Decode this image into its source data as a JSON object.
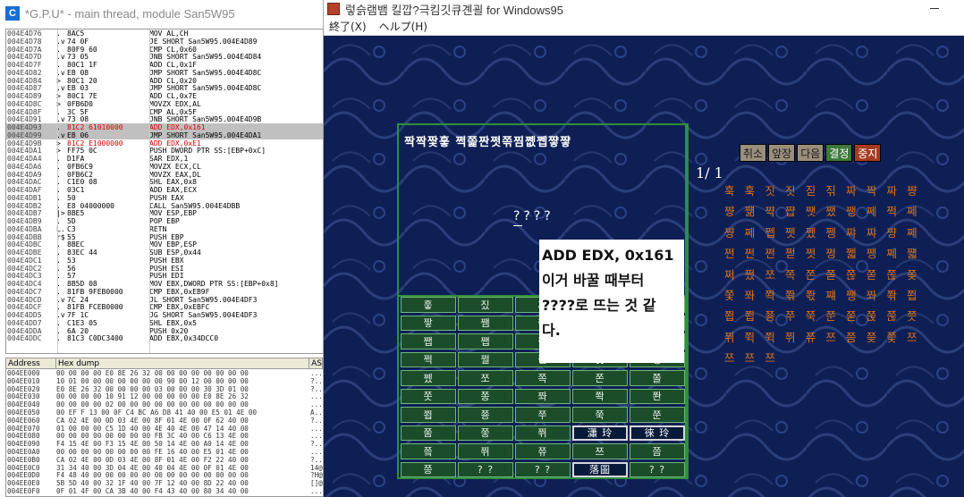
{
  "debugger": {
    "title": "*G.P.U* - main thread, module San5W95",
    "icon_letter": "C",
    "cpu_rows": [
      {
        "addr": "004E4D76",
        "mark": ".",
        "hex": "8AC5",
        "dis": "MOV AL,CH"
      },
      {
        "addr": "004E4D78",
        "mark": ".v",
        "hex": "74 0F",
        "dis": "JE SHORT San5W95.004E4D89"
      },
      {
        "addr": "004E4D7A",
        "mark": ".",
        "hex": "80F9 60",
        "dis": "CMP CL,0x60"
      },
      {
        "addr": "004E4D7D",
        "mark": ".v",
        "hex": "73 05",
        "dis": "JNB SHORT San5W95.004E4D84"
      },
      {
        "addr": "004E4D7F",
        "mark": ".",
        "hex": "80C1 1F",
        "dis": "ADD CL,0x1F"
      },
      {
        "addr": "004E4D82",
        "mark": ".v",
        "hex": "EB 08",
        "dis": "JMP SHORT San5W95.004E4D8C"
      },
      {
        "addr": "004E4D84",
        "mark": ">",
        "hex": "80C1 20",
        "dis": "ADD CL,0x20"
      },
      {
        "addr": "004E4D87",
        "mark": ".v",
        "hex": "EB 03",
        "dis": "JMP SHORT San5W95.004E4D8C"
      },
      {
        "addr": "004E4D89",
        "mark": ">",
        "hex": "80C1 7E",
        "dis": "ADD CL,0x7E"
      },
      {
        "addr": "004E4D8C",
        "mark": ">",
        "hex": "0FB6D0",
        "dis": "MOVZX EDX,AL"
      },
      {
        "addr": "004E4D8F",
        "mark": ".",
        "hex": "3C 5F",
        "dis": "CMP AL,0x5F"
      },
      {
        "addr": "004E4D91",
        "mark": ".v",
        "hex": "73 08",
        "dis": "JNB SHORT San5W95.004E4D9B"
      },
      {
        "addr": "004E4D93",
        "mark": ".",
        "hex": "81C2 61010000",
        "dis": "ADD EDX,0x161",
        "sel": true,
        "red": true
      },
      {
        "addr": "004E4D99",
        "mark": ".v",
        "hex": "EB 06",
        "dis": "JMP SHORT San5W95.004E4DA1",
        "sel": true
      },
      {
        "addr": "004E4D9B",
        "mark": ">",
        "hex": "81C2 E1000000",
        "dis": "ADD EDX,0xE1",
        "red": true
      },
      {
        "addr": "004E4DA1",
        "mark": ">",
        "hex": "FF75 0C",
        "dis": "PUSH DWORD PTR SS:[EBP+0xC]"
      },
      {
        "addr": "004E4DA4",
        "mark": ".",
        "hex": "D1FA",
        "dis": "SAR EDX,1"
      },
      {
        "addr": "004E4DA6",
        "mark": ".",
        "hex": "0FB6C9",
        "dis": "MOVZX ECX,CL"
      },
      {
        "addr": "004E4DA9",
        "mark": ".",
        "hex": "0FB6C2",
        "dis": "MOVZX EAX,DL"
      },
      {
        "addr": "004E4DAC",
        "mark": ".",
        "hex": "C1E0 08",
        "dis": "SHL EAX,0x8"
      },
      {
        "addr": "004E4DAF",
        "mark": ".",
        "hex": "03C1",
        "dis": "ADD EAX,ECX"
      },
      {
        "addr": "004E4DB1",
        "mark": ".",
        "hex": "50",
        "dis": "PUSH EAX"
      },
      {
        "addr": "004E4DB2",
        "mark": ".",
        "hex": "E8 04000000",
        "dis": "CALL San5W95.004E4DBB"
      },
      {
        "addr": "004E4DB7",
        "mark": "|>",
        "hex": "8BE5",
        "dis": "MOV ESP,EBP"
      },
      {
        "addr": "004E4DB9",
        "mark": ".",
        "hex": "5D",
        "dis": "POP EBP"
      },
      {
        "addr": "004E4DBA",
        "mark": "L.",
        "hex": "C3",
        "dis": "RETN"
      },
      {
        "addr": "004E4DBB",
        "mark": "r$",
        "hex": "55",
        "dis": "PUSH EBP"
      },
      {
        "addr": "004E4DBC",
        "mark": ".",
        "hex": "8BEC",
        "dis": "MOV EBP,ESP"
      },
      {
        "addr": "004E4DBE",
        "mark": ".",
        "hex": "83EC 44",
        "dis": "SUB ESP,0x44"
      },
      {
        "addr": "004E4DC1",
        "mark": ".",
        "hex": "53",
        "dis": "PUSH EBX"
      },
      {
        "addr": "004E4DC2",
        "mark": ".",
        "hex": "56",
        "dis": "PUSH ESI"
      },
      {
        "addr": "004E4DC3",
        "mark": ".",
        "hex": "57",
        "dis": "PUSH EDI"
      },
      {
        "addr": "004E4DC4",
        "mark": ".",
        "hex": "8B5D 08",
        "dis": "MOV EBX,DWORD PTR SS:[EBP+0x8]"
      },
      {
        "addr": "004E4DC7",
        "mark": ".",
        "hex": "81FB 9FEB0000",
        "dis": "CMP EBX,0xEB9F"
      },
      {
        "addr": "004E4DCD",
        "mark": ".v",
        "hex": "7C 24",
        "dis": "JL SHORT San5W95.004E4DF3"
      },
      {
        "addr": "004E4DCF",
        "mark": ".",
        "hex": "81FB FCEB0000",
        "dis": "CMP EBX,0xEBFC"
      },
      {
        "addr": "004E4DD5",
        "mark": ".v",
        "hex": "7F 1C",
        "dis": "JG SHORT San5W95.004E4DF3"
      },
      {
        "addr": "004E4DD7",
        "mark": ".",
        "hex": "C1E3 05",
        "dis": "SHL EBX,0x5"
      },
      {
        "addr": "004E4DDA",
        "mark": ".",
        "hex": "6A 20",
        "dis": "PUSH 0x20"
      },
      {
        "addr": "004E4DDC",
        "mark": ".",
        "hex": "81C3 C0DC3400",
        "dis": "ADD EBX,0x34DCC0"
      }
    ],
    "dump_headers": [
      "Address",
      "Hex dump",
      "AS"
    ],
    "dump_rows": [
      {
        "addr": "004EE000",
        "hex": "00 00 00 00 E0 8E 26 32 00 00 00 00 00 00 00 00",
        "asc": "...."
      },
      {
        "addr": "004EE010",
        "hex": "10 01 00 00 00 00 00 00 00 90 00 12 00 00 00 00",
        "asc": "?.."
      },
      {
        "addr": "004EE020",
        "hex": "E0 8E 26 32 00 00 00 00 03 00 00 00 30 3D 01 00",
        "asc": "?.."
      },
      {
        "addr": "004EE030",
        "hex": "00 00 00 00 10 91 12 00 00 00 00 00 E0 8E 26 32",
        "asc": "...."
      },
      {
        "addr": "004EE040",
        "hex": "00 00 00 00 02 00 00 00 00 00 00 00 00 00 00 00",
        "asc": "...."
      },
      {
        "addr": "004EE050",
        "hex": "00 EF F 13 00 0F C4 BC A6 D8 41 40 00 E5 01 4E 00",
        "asc": "A.."
      },
      {
        "addr": "004EE060",
        "hex": "CA 02 4E 00 0D 03 4E 00 8F 01 4E 00 0F 62 40 00",
        "asc": "?.."
      },
      {
        "addr": "004EE070",
        "hex": "01 00 00 00 C5 1D 40 00 4E 40 4E 00 47 14 40 00",
        "asc": "...."
      },
      {
        "addr": "004EE080",
        "hex": "00 00 00 00 00 00 00 00 FB 3C 40 00 C6 13 4E 00",
        "asc": "...."
      },
      {
        "addr": "004EE090",
        "hex": "F4 15 4E 00 F3 15 4E 00 50 14 4E 00 A0 14 4E 00",
        "asc": "?.."
      },
      {
        "addr": "004EE0A0",
        "hex": "00 00 00 00 00 00 00 00 FE 16 40 00 E5 01 4E 00",
        "asc": "...."
      },
      {
        "addr": "004EE0B0",
        "hex": "CA 02 4E 00 0D 03 4E 00 8F 01 4E 00 F2 22 40 00",
        "asc": "?.."
      },
      {
        "addr": "004EE0C0",
        "hex": "31 34 40 00 3D 04 4E 00 40 04 4E 00 0F 01 4E 00",
        "asc": "14@."
      },
      {
        "addr": "004EE0D0",
        "hex": "F4 48 40 00 00 00 00 00 00 00 00 00 00 00 00 00",
        "asc": "?H@."
      },
      {
        "addr": "004EE0E0",
        "hex": "5B 5D 40 00 32 1F 40 00 7F 12 40 00 8D 22 40 00",
        "asc": "[]@."
      },
      {
        "addr": "004EE0F0",
        "hex": "0F 01 4F 00 CA 3B 40 00 F4 43 40 00 80 34 40 00",
        "asc": "...."
      }
    ]
  },
  "game": {
    "title": "렇슭램뱀 킬깝?극킴깃큐곈괼 for Windows95",
    "menu": [
      "終了(X)",
      "ヘルプ(H)"
    ],
    "board_title": "짝짝짳훟 쩍쫉짠쩟쪾찜쩺쩹쨯쨯",
    "board_qm": "????",
    "grid": [
      [
        "훟",
        "짔",
        "짜",
        "짝",
        "짯"
      ],
      [
        "짷",
        "쨈",
        "쨋",
        "쨍",
        "쨰"
      ],
      [
        "쨉",
        "쨉",
        "쨌",
        "쨉",
        "쨐"
      ],
      [
        "쩍",
        "쩔",
        "쩝",
        "쩟",
        "쩡"
      ],
      [
        "쩼",
        "쪼",
        "쪽",
        "쫀",
        "쫄"
      ],
      [
        "쫏",
        "쫑",
        "쫘",
        "쫙",
        "쫜"
      ],
      [
        "쬡",
        "쭁",
        "쭈",
        "쭉",
        "쭌"
      ],
      [
        "쭘",
        "쭝",
        "쮜",
        "瀟 玲",
        "徠 玲"
      ],
      [
        "쯬",
        "쮜",
        "쮸",
        "쯔",
        "쯤"
      ],
      [
        "쯩",
        "? ?",
        "? ?",
        "落圖",
        "? ?"
      ]
    ],
    "selected_cells": [
      [
        7,
        3
      ],
      [
        7,
        4
      ],
      [
        9,
        3
      ]
    ],
    "buttons": [
      {
        "label": "취소",
        "style": "grey"
      },
      {
        "label": "앞장",
        "style": "grey"
      },
      {
        "label": "다음",
        "style": "grey"
      },
      {
        "label": "결정",
        "style": "green"
      },
      {
        "label": "중지",
        "style": "red"
      }
    ],
    "page_no": "1/ 1",
    "candidate_lines": [
      "훅 훅 짓 짓 짇 짂 짜 짝 짜 쨩",
      "쨩 쨺 쨕 쨥 쨋 쨌 쨍 쩨 쩍 쩨",
      "쨩 쩨 쩹 쩻 쩼 쩽 쨔 쨔 쨩 쩨",
      "쩐 쩐 쩐 쩓 쩟 쩡 쩳 쨍 쩨 쨻",
      "쩌 쩠 쪼 쪽 쫀 쫃 쫂 쫃 쫂 쫒",
      "쫓 쫘 쫙 쫚 쫛 쨰 쨍 쫘 쫚 쬡",
      "쬡 쬡 쭁 쭈 쭉 쭌 쭏 쭍 쭎 쯧",
      "쮜 쮝 쮝 쮜 쮸 쯔 쯤 쯪 쯫 쯔",
      "쯔 쯔 쯔"
    ],
    "note_lines": [
      "ADD EDX, 0x161",
      "이거 바꿀 때부터",
      "????로 뜨는 것 같",
      "다."
    ]
  },
  "colors": {
    "canvas_bg": "#0e1f55",
    "board_frame": "#2f8f3a",
    "candidate_text": "#d9731c",
    "highlight_red": "#e00000"
  }
}
